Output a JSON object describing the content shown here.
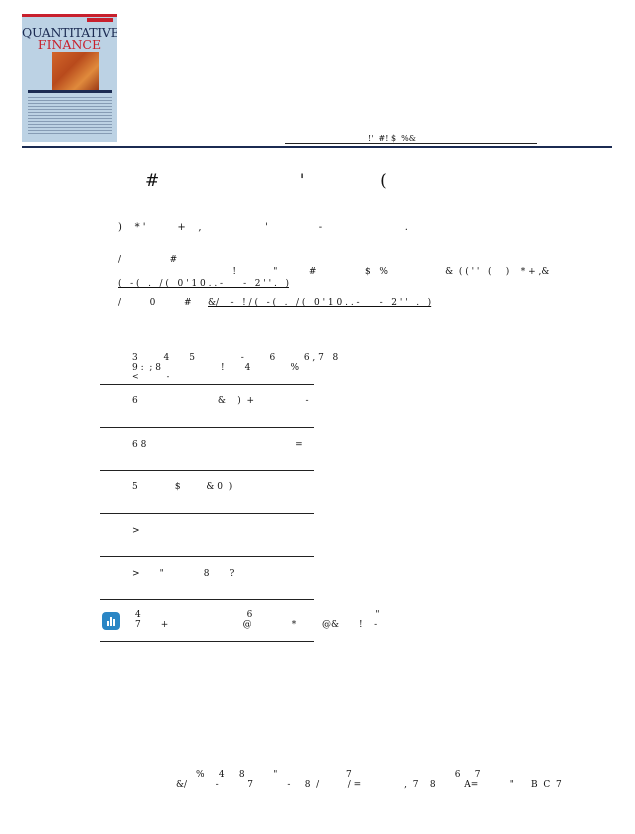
{
  "cover": {
    "title_line1": "QUANTITATIVE",
    "title_line2": "FINANCE"
  },
  "header_link": "!'  #! $  %&",
  "article": {
    "title": "#                          '              (",
    "authors": ")    * '          +    ,                    '                -                          .",
    "cite_label": "/                 #",
    "cite_text": "                                        !             \"           #                 $   %                    &  ( ( ' '   (     )    * + ,&",
    "cite_link": "(   - (   .   / (   0 ' 1 0 . . -       -   2 ' ' .   )",
    "link_label": "/          0          #",
    "link_url": "&/    -   ! / (   - (   .   / (   0 ' 1 0 . . -       -   2 ' '   .   )"
  },
  "details": {
    "line1": "3         4       5                -         6          6 , 7   8",
    "line2": "9 :  ; 8                     !       4              %",
    "line3": "<           -"
  },
  "items": [
    {
      "text": "6                            &    )  +                  -"
    },
    {
      "text": "6 8                                                    ="
    },
    {
      "text": "5             $         & 0  )"
    },
    {
      "text": ">"
    },
    {
      "text": ">       \"              8       ?"
    }
  ],
  "metrics": {
    "line1": "4                                     6                                           \"",
    "line2": "7       +                          @              *         @&       !    -"
  },
  "footer": {
    "line1": "%     4     8          \"                        7                                    6     7",
    "line2": "&/          -          7            -     8  /          / =               ,  7    8          A=           \"      B  C  7"
  },
  "colors": {
    "navy": "#1b2b52",
    "red": "#c8202d",
    "cover_bg": "#bcd2e4",
    "metric_logo": "#2a86c5"
  }
}
